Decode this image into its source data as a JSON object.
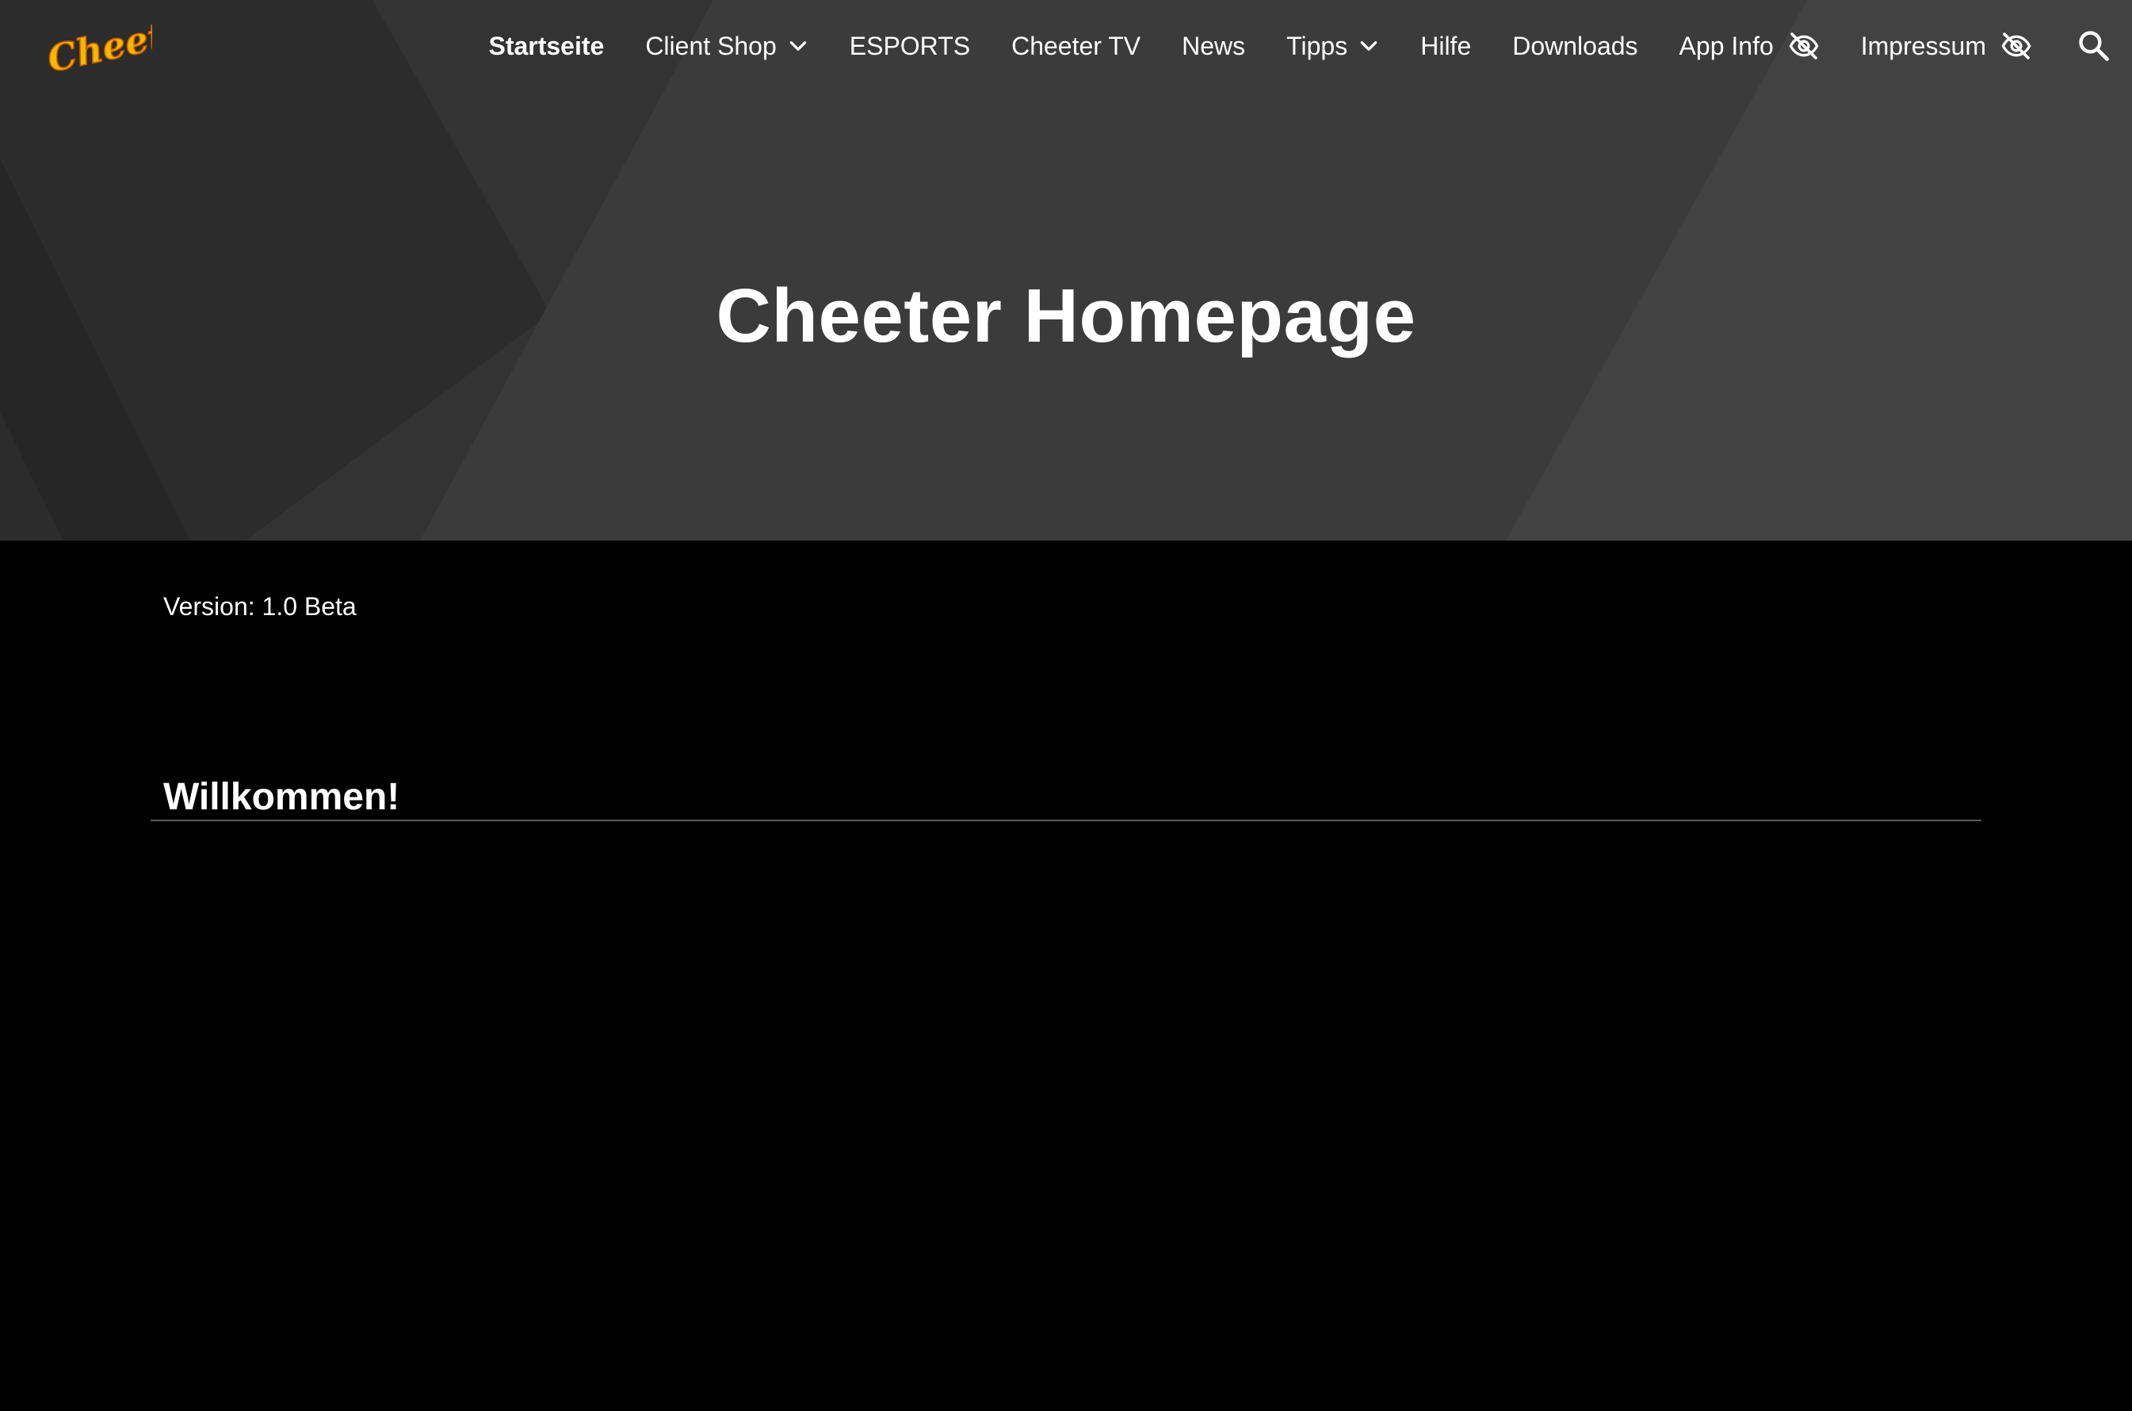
{
  "brand": {
    "logo_text": "Cheeter",
    "logo_color": "#F5B800",
    "logo_outline": "#C25A00"
  },
  "nav": {
    "items": [
      {
        "label": "Startseite",
        "active": true,
        "dropdown": false,
        "hidden_icon": false
      },
      {
        "label": "Client Shop",
        "active": false,
        "dropdown": true,
        "hidden_icon": false
      },
      {
        "label": "ESPORTS",
        "active": false,
        "dropdown": false,
        "hidden_icon": false
      },
      {
        "label": "Cheeter TV",
        "active": false,
        "dropdown": false,
        "hidden_icon": false
      },
      {
        "label": "News",
        "active": false,
        "dropdown": false,
        "hidden_icon": false
      },
      {
        "label": "Tipps",
        "active": false,
        "dropdown": true,
        "hidden_icon": false
      },
      {
        "label": "Hilfe",
        "active": false,
        "dropdown": false,
        "hidden_icon": false
      },
      {
        "label": "Downloads",
        "active": false,
        "dropdown": false,
        "hidden_icon": false
      },
      {
        "label": "App Info",
        "active": false,
        "dropdown": false,
        "hidden_icon": true
      },
      {
        "label": "Impressum",
        "active": false,
        "dropdown": false,
        "hidden_icon": true
      }
    ],
    "icons": {
      "dropdown": "chevron-down-icon",
      "hidden": "eye-off-icon",
      "search": "search-icon"
    }
  },
  "hero": {
    "title": "Cheeter Homepage"
  },
  "content": {
    "version_text": "Version: 1.0 Beta",
    "section_title": "Willkommen!"
  },
  "colors": {
    "hero_background": "#3A3A3A",
    "page_background": "#000000",
    "text": "#FFFFFF",
    "divider": "#5A5A5A"
  }
}
